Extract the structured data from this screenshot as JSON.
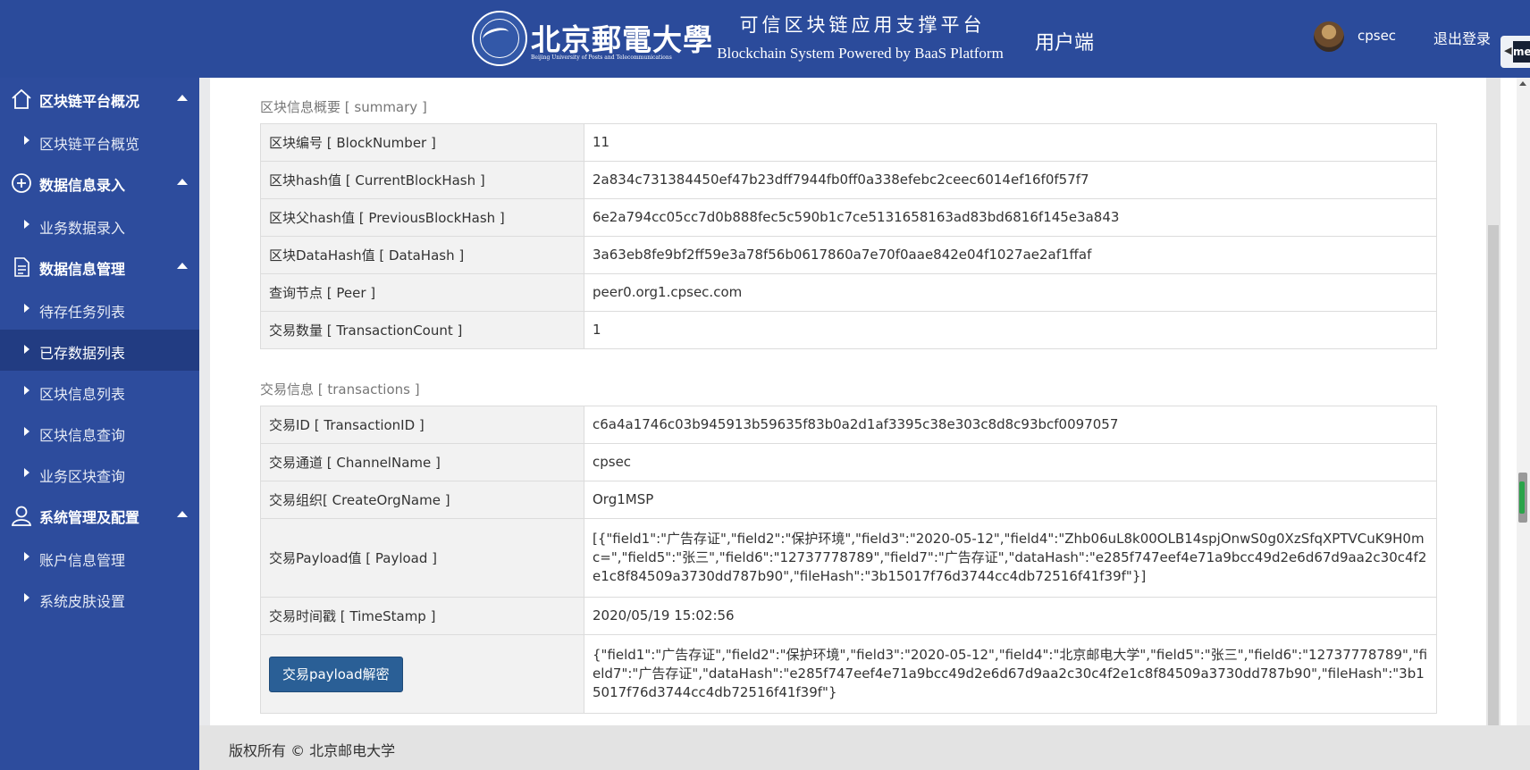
{
  "header": {
    "logo_cn": "北京郵電大學",
    "logo_en": "Beijing University of Posts and Telecommunications",
    "platform_cn": "可信区块链应用支撑平台",
    "platform_en": "Blockchain System Powered by BaaS Platform",
    "role": "用户端",
    "username": "cpsec",
    "logout": "退出登录",
    "ext_badge": "me"
  },
  "sidebar": {
    "groups": [
      {
        "label": "区块链平台概况",
        "icon": "home-icon",
        "items": [
          {
            "label": "区块链平台概览"
          }
        ]
      },
      {
        "label": "数据信息录入",
        "icon": "plus-circle-icon",
        "items": [
          {
            "label": "业务数据录入"
          }
        ]
      },
      {
        "label": "数据信息管理",
        "icon": "document-icon",
        "items": [
          {
            "label": "待存任务列表"
          },
          {
            "label": "已存数据列表"
          },
          {
            "label": "区块信息列表"
          },
          {
            "label": "区块信息查询"
          },
          {
            "label": "业务区块查询"
          }
        ]
      },
      {
        "label": "系统管理及配置",
        "icon": "user-icon",
        "items": [
          {
            "label": "账户信息管理"
          },
          {
            "label": "系统皮肤设置"
          }
        ]
      }
    ],
    "active_item": "已存数据列表"
  },
  "summary": {
    "title": "区块信息概要 [ summary ]",
    "rows": [
      {
        "key": "区块编号 [ BlockNumber ]",
        "value": "11"
      },
      {
        "key": "区块hash值 [ CurrentBlockHash ]",
        "value": "2a834c731384450ef47b23dff7944fb0ff0a338efebc2ceec6014ef16f0f57f7"
      },
      {
        "key": "区块父hash值 [ PreviousBlockHash ]",
        "value": "6e2a794cc05cc7d0b888fec5c590b1c7ce5131658163ad83bd6816f145e3a843"
      },
      {
        "key": "区块DataHash值 [ DataHash ]",
        "value": "3a63eb8fe9bf2ff59e3a78f56b0617860a7e70f0aae842e04f1027ae2af1ffaf"
      },
      {
        "key": "查询节点 [ Peer ]",
        "value": "peer0.org1.cpsec.com"
      },
      {
        "key": "交易数量 [ TransactionCount ]",
        "value": "1"
      }
    ]
  },
  "transactions": {
    "title": "交易信息 [ transactions ]",
    "rows": [
      {
        "key": "交易ID [ TransactionID ]",
        "value": "c6a4a1746c03b945913b59635f83b0a2d1af3395c38e303c8d8c93bcf0097057"
      },
      {
        "key": "交易通道 [ ChannelName ]",
        "value": "cpsec"
      },
      {
        "key": "交易组织[ CreateOrgName ]",
        "value": "Org1MSP"
      },
      {
        "key": "交易Payload值 [ Payload ]",
        "value": "[{\"field1\":\"广告存证\",\"field2\":\"保护环境\",\"field3\":\"2020-05-12\",\"field4\":\"Zhb06uL8k00OLB14spjOnwS0g0XzSfqXPTVCuK9H0mc=\",\"field5\":\"张三\",\"field6\":\"12737778789\",\"field7\":\"广告存证\",\"dataHash\":\"e285f747eef4e71a9bcc49d2e6d67d9aa2c30c4f2e1c8f84509a3730dd787b90\",\"fileHash\":\"3b15017f76d3744cc4db72516f41f39f\"}]"
      },
      {
        "key": "交易时间戳 [ TimeStamp ]",
        "value": "2020/05/19 15:02:56"
      }
    ],
    "decode_button": "交易payload解密",
    "decoded_value": "{\"field1\":\"广告存证\",\"field2\":\"保护环境\",\"field3\":\"2020-05-12\",\"field4\":\"北京邮电大学\",\"field5\":\"张三\",\"field6\":\"12737778789\",\"field7\":\"广告存证\",\"dataHash\":\"e285f747eef4e71a9bcc49d2e6d67d9aa2c30c4f2e1c8f84509a3730dd787b90\",\"fileHash\":\"3b15017f76d3744cc4db72516f41f39f\"}"
  },
  "footer": {
    "text": "版权所有 © 北京邮电大学"
  },
  "colors": {
    "header_bg": "#2b4b9b",
    "sidebar_bg": "#2d4c9d",
    "active_item_bg": "#223c82",
    "button_bg": "#2a5f96"
  }
}
